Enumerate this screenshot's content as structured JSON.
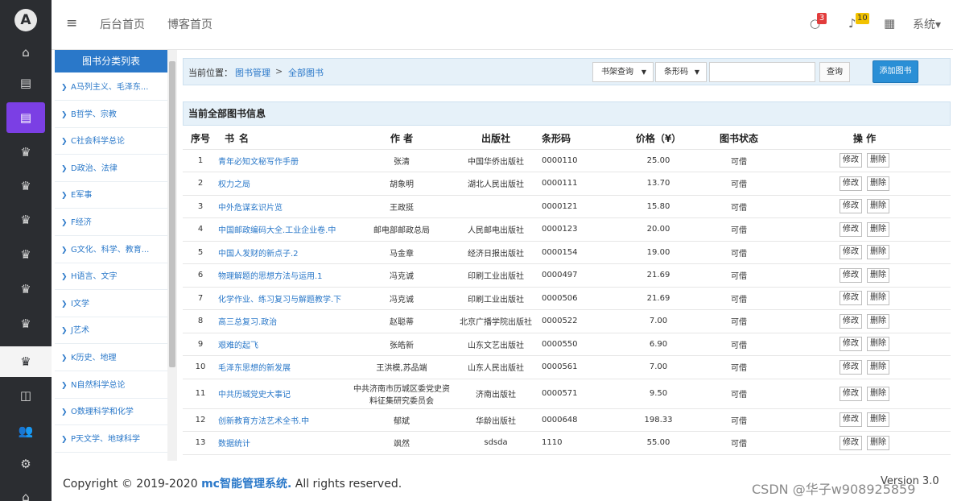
{
  "rail": {
    "logo": "A"
  },
  "topbar": {
    "menu_icon": "≡",
    "nav_items": [
      "后台首页",
      "博客首页"
    ],
    "message_badge": "3",
    "notice_badge": "10",
    "system_label": "系统▾"
  },
  "categories": {
    "title": "图书分类列表",
    "items": [
      "A马列主义、毛泽东...",
      "B哲学、宗教",
      "C社会科学总论",
      "D政治、法律",
      "E军事",
      "F经济",
      "G文化、科学、教育...",
      "H语言、文字",
      "I文学",
      "J艺术",
      "K历史、地理",
      "N自然科学总论",
      "O数理科学和化学",
      "P天文学、地球科学"
    ]
  },
  "breadcrumb": {
    "label": "当前位置：",
    "link1": "图书管理",
    "sep": ">",
    "link2": "全部图书"
  },
  "search": {
    "type_select": "书架查询",
    "field_select": "条形码",
    "query_button": "查询",
    "add_button": "添加图书"
  },
  "panel_title": "当前全部图书信息",
  "table": {
    "headers": {
      "no": "序号",
      "name": "书名",
      "author": "作 者",
      "publisher": "出版社",
      "barcode": "条形码",
      "price": "价格（¥）",
      "status": "图书状态",
      "ops": "操 作"
    },
    "edit_label": "修改",
    "delete_label": "删除",
    "rows": [
      {
        "no": "1",
        "name": "青年必知文秘写作手册",
        "author": "张清",
        "publisher": "中国华侨出版社",
        "barcode": "0000110",
        "price": "25.00",
        "status": "可借"
      },
      {
        "no": "2",
        "name": "权力之局",
        "author": "胡象明",
        "publisher": "湖北人民出版社",
        "barcode": "0000111",
        "price": "13.70",
        "status": "可借"
      },
      {
        "no": "3",
        "name": "中外危谋玄识片览",
        "author": "王政挺",
        "publisher": "",
        "barcode": "0000121",
        "price": "15.80",
        "status": "可借"
      },
      {
        "no": "4",
        "name": "中国邮政编码大全.工业企业卷.中",
        "author": "邮电部邮政总局",
        "publisher": "人民邮电出版社",
        "barcode": "0000123",
        "price": "20.00",
        "status": "可借"
      },
      {
        "no": "5",
        "name": "中国人发财的新点子.2",
        "author": "马金章",
        "publisher": "经济日报出版社",
        "barcode": "0000154",
        "price": "19.00",
        "status": "可借"
      },
      {
        "no": "6",
        "name": "物理解题的思想方法与运用.1",
        "author": "冯克诚",
        "publisher": "印刷工业出版社",
        "barcode": "0000497",
        "price": "21.69",
        "status": "可借"
      },
      {
        "no": "7",
        "name": "化学作业、练习复习与解题教学.下",
        "author": "冯克诚",
        "publisher": "印刷工业出版社",
        "barcode": "0000506",
        "price": "21.69",
        "status": "可借"
      },
      {
        "no": "8",
        "name": "高三总复习.政治",
        "author": "赵聪蒂",
        "publisher": "北京广播学院出版社",
        "barcode": "0000522",
        "price": "7.00",
        "status": "可借"
      },
      {
        "no": "9",
        "name": "艰难的起飞",
        "author": "张皓新",
        "publisher": "山东文艺出版社",
        "barcode": "0000550",
        "price": "6.90",
        "status": "可借"
      },
      {
        "no": "10",
        "name": "毛泽东思想的新发展",
        "author": "王洪模,苏品端",
        "publisher": "山东人民出版社",
        "barcode": "0000561",
        "price": "7.00",
        "status": "可借"
      },
      {
        "no": "11",
        "name": "中共历城党史大事记",
        "author": "中共济南市历城区委党史资料征集研究委员会",
        "publisher": "济南出版社",
        "barcode": "0000571",
        "price": "9.50",
        "status": "可借"
      },
      {
        "no": "12",
        "name": "创新教育方法艺术全书.中",
        "author": "郁斌",
        "publisher": "华龄出版社",
        "barcode": "0000648",
        "price": "198.33",
        "status": "可借"
      },
      {
        "no": "13",
        "name": "数据统计",
        "author": "飒然",
        "publisher": "sdsda",
        "barcode": "1110",
        "price": "55.00",
        "status": "可借"
      }
    ]
  },
  "footer": {
    "copyright_prefix": "Copyright © 2019-2020 ",
    "brand": "mc智能管理系统.",
    "copyright_suffix": " All rights reserved.",
    "version": "Version 3.0",
    "watermark": "CSDN @华子w908925859"
  },
  "colors": {
    "rail_bg": "#2b2d31",
    "rail_active": "#7b3fe4",
    "accent": "#2a78c9",
    "panel_bg": "#e6f1f9",
    "badge_red": "#e23c3c",
    "badge_yellow": "#f2c200"
  }
}
